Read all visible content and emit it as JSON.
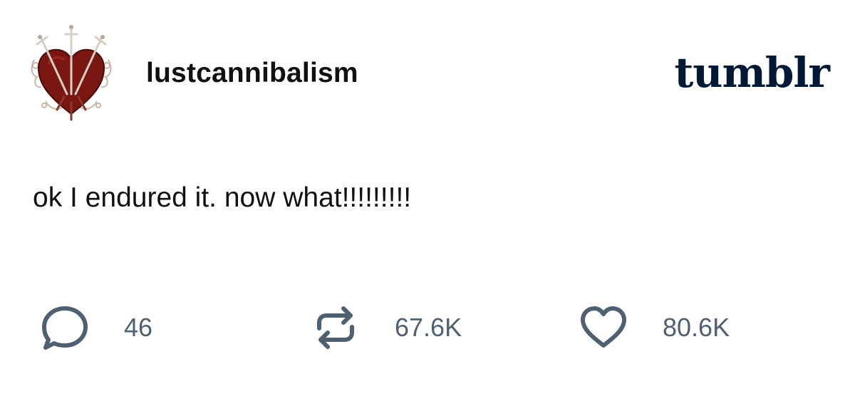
{
  "post": {
    "username": "lustcannibalism",
    "text": "ok I endured it. now what!!!!!!!!!"
  },
  "brand": {
    "logo_text": "tumblr",
    "color": "#001935"
  },
  "actions": {
    "comments": {
      "count": "46",
      "icon": "speech-bubble-icon"
    },
    "reblogs": {
      "count": "67.6K",
      "icon": "reblog-icon"
    },
    "likes": {
      "count": "80.6K",
      "icon": "heart-icon"
    },
    "icon_color": "#4f6071"
  }
}
